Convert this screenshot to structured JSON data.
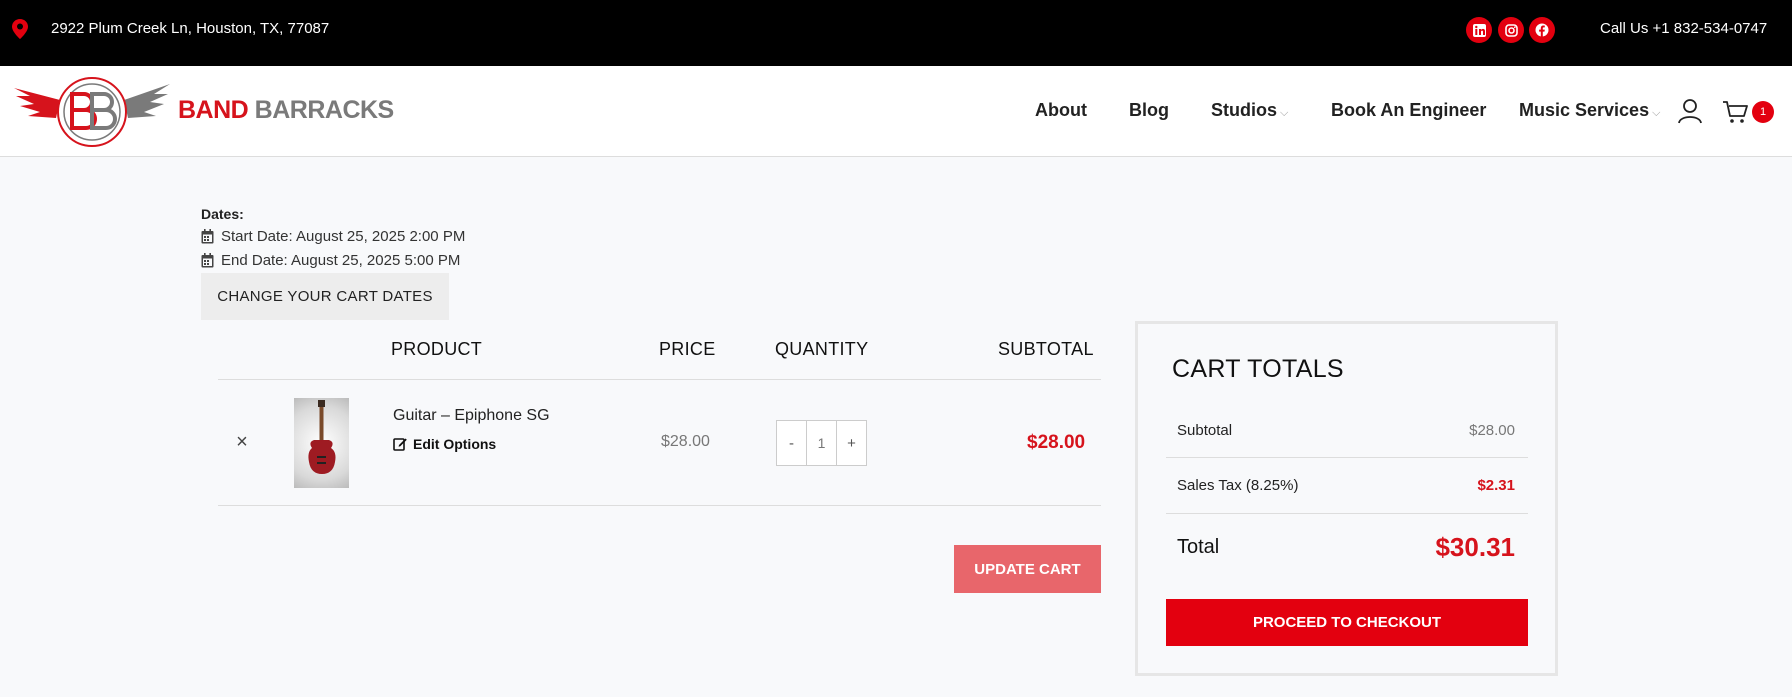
{
  "topbar": {
    "address": "2922 Plum Creek Ln, Houston, TX, 77087",
    "phone": "Call Us +1 832-534-0747",
    "social": [
      "linkedin-icon",
      "instagram-icon",
      "facebook-icon"
    ]
  },
  "header": {
    "brand_red": "BAND",
    "brand_gray": "BARRACKS",
    "nav": {
      "about": "About",
      "blog": "Blog",
      "studios": "Studios",
      "engineer": "Book An Engineer",
      "music_services": "Music Services"
    },
    "cart_count": "1"
  },
  "dates": {
    "label": "Dates:",
    "start": "Start Date: August 25, 2025 2:00 PM",
    "end": "End Date: August 25, 2025 5:00 PM",
    "change_button": "CHANGE YOUR CART DATES"
  },
  "cart": {
    "headers": {
      "product": "PRODUCT",
      "price": "PRICE",
      "quantity": "QUANTITY",
      "subtotal": "SUBTOTAL"
    },
    "items": [
      {
        "remove": "×",
        "name": "Guitar – Epiphone SG",
        "edit": "Edit Options",
        "price": "$28.00",
        "qty_minus": "-",
        "qty": "1",
        "qty_plus": "+",
        "subtotal": "$28.00"
      }
    ],
    "update_button": "UPDATE CART"
  },
  "totals": {
    "title": "CART TOTALS",
    "subtotal_label": "Subtotal",
    "subtotal_value": "$28.00",
    "tax_label": "Sales Tax (8.25%)",
    "tax_value": "$2.31",
    "total_label": "Total",
    "total_value": "$30.31",
    "checkout_button": "PROCEED TO CHECKOUT"
  },
  "colors": {
    "accent": "#e3000f",
    "brand_red": "#d6131c",
    "brand_gray": "#7a7a7a",
    "update_button": "#e8666b"
  }
}
